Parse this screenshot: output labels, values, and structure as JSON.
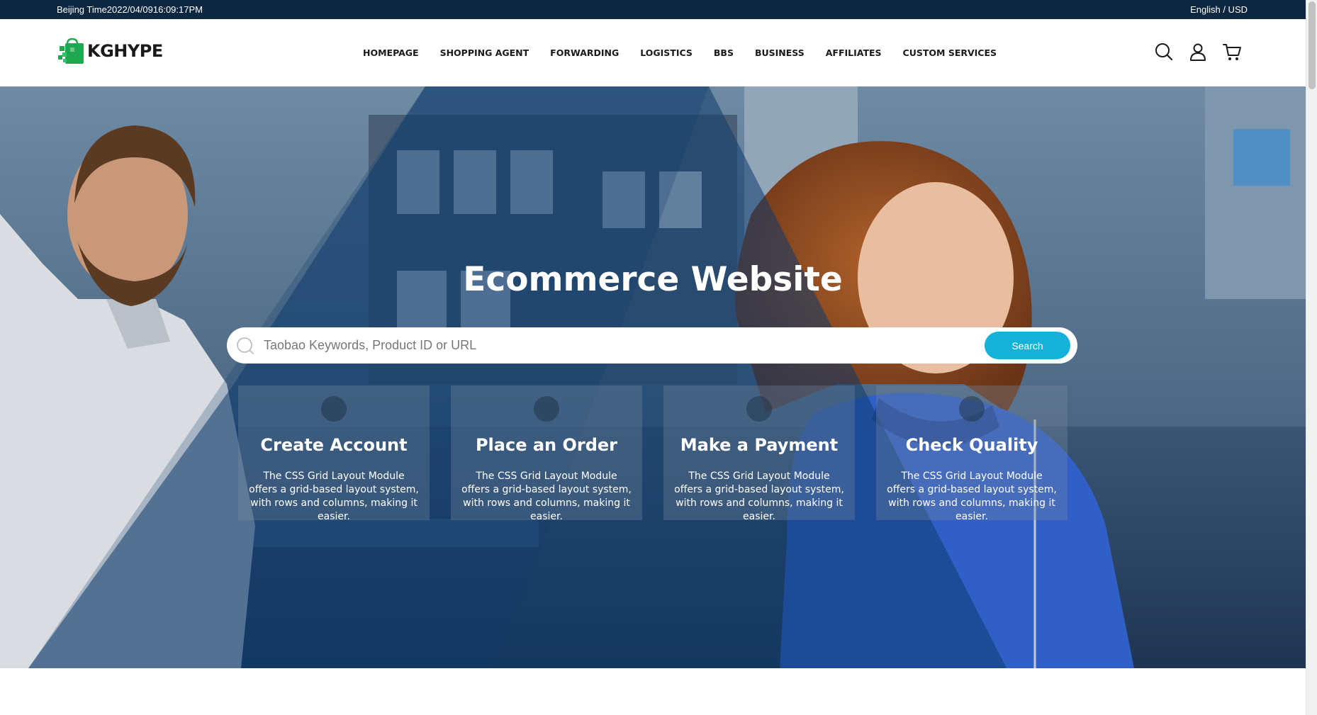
{
  "topbar": {
    "time_text": "Beijing Time2022/04/0916:09:17PM",
    "lang_text": "English / USD"
  },
  "header": {
    "logo_text": "KGHYPE",
    "nav": [
      {
        "label": "HOMEPAGE"
      },
      {
        "label": "SHOPPING AGENT"
      },
      {
        "label": "FORWARDING"
      },
      {
        "label": "LOGISTICS"
      },
      {
        "label": "BBS"
      },
      {
        "label": "BUSINESS"
      },
      {
        "label": "AFFILIATES"
      },
      {
        "label": "CUSTOM SERVICES"
      }
    ],
    "icons": [
      "search-icon",
      "user-icon",
      "cart-icon"
    ]
  },
  "hero": {
    "title": "Ecommerce Website",
    "search": {
      "placeholder": "Taobao Keywords, Product ID or URL",
      "value": "",
      "button_label": "Search"
    },
    "steps": [
      {
        "title": "Create Account",
        "desc": "The CSS Grid Layout Module offers a grid-based layout system, with rows and columns, making it easier."
      },
      {
        "title": "Place an Order",
        "desc": "The CSS Grid Layout Module offers a grid-based layout system, with rows and columns, making it easier."
      },
      {
        "title": "Make a Payment",
        "desc": "The CSS Grid Layout Module offers a grid-based layout system, with rows and columns, making it easier."
      },
      {
        "title": "Check Quality",
        "desc": "The CSS Grid Layout Module offers a grid-based layout system, with rows and columns, making it easier."
      }
    ]
  },
  "colors": {
    "topbar": "#0d2740",
    "accent": "#14b2d8",
    "logo_green": "#1fa84f"
  }
}
